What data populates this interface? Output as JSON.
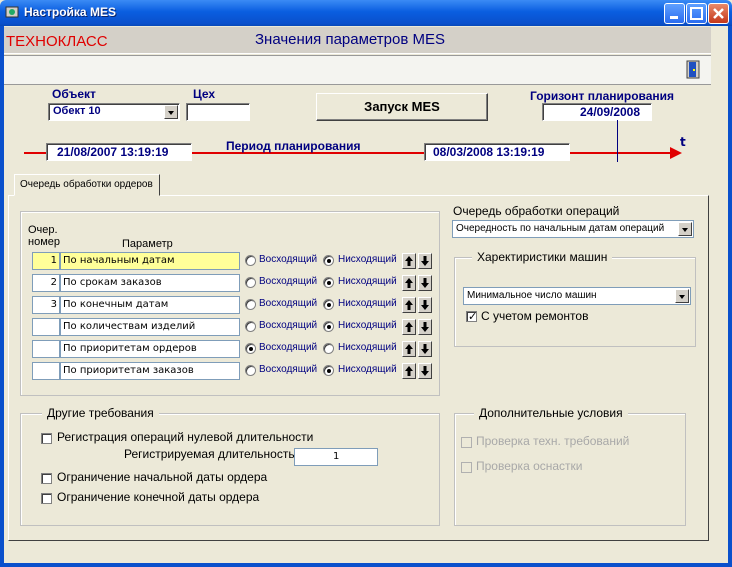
{
  "window": {
    "title": "Настройка MES",
    "icon": "app-icon"
  },
  "header": {
    "brand": "ТЕХНОКЛАСС",
    "title": "Значения параметров MES"
  },
  "toolbar": {
    "exit_icon": "exit-door-icon"
  },
  "object": {
    "label": "Объект",
    "value": "Обект 10"
  },
  "workshop": {
    "label": "Цех",
    "value": ""
  },
  "run_button": "Запуск MES",
  "horizon": {
    "label": "Горизонт планирования",
    "value": "24/09/2008"
  },
  "period": {
    "label": "Период планирования",
    "start": "21/08/2007 13:19:19",
    "end": "08/03/2008 13:19:19",
    "marker": "t"
  },
  "tab": {
    "label": "Очередь обработки ордеров"
  },
  "orders": {
    "col_num_line1": "Очер.",
    "col_num_line2": "номер",
    "col_param": "Параметр",
    "asc_label": "Восходящий",
    "desc_label": "Нисходящий",
    "rows": [
      {
        "num": "1",
        "param": "По начальным датам",
        "order": "desc",
        "highlight": true
      },
      {
        "num": "2",
        "param": "По срокам заказов",
        "order": "desc",
        "highlight": false
      },
      {
        "num": "3",
        "param": "По конечным датам",
        "order": "desc",
        "highlight": false
      },
      {
        "num": "",
        "param": "По количествам изделий",
        "order": "desc",
        "highlight": false
      },
      {
        "num": "",
        "param": "По приоритетам ордеров",
        "order": "asc",
        "highlight": false
      },
      {
        "num": "",
        "param": "По приоритетам заказов",
        "order": "desc",
        "highlight": false
      }
    ]
  },
  "operations_queue": {
    "label": "Очередь обработки операций",
    "value": "Очередность по начальным датам операций"
  },
  "machines": {
    "legend": "Харектиристики машин",
    "select_value": "Минимальное число машин",
    "repairs_label": "С учетом ремонтов",
    "repairs_checked": true
  },
  "other": {
    "legend": "Другие требования",
    "zero_ops_label": "Регистрация операций нулевой длительности",
    "duration_label": "Регистрируемая длительность",
    "duration_value": "1",
    "start_limit_label": "Ограничение начальной даты ордера",
    "end_limit_label": "Ограничение конечной даты ордера"
  },
  "extra": {
    "legend": "Дополнительные условия",
    "tech_label": "Проверка техн. требований",
    "tooling_label": "Проверка оснастки"
  }
}
